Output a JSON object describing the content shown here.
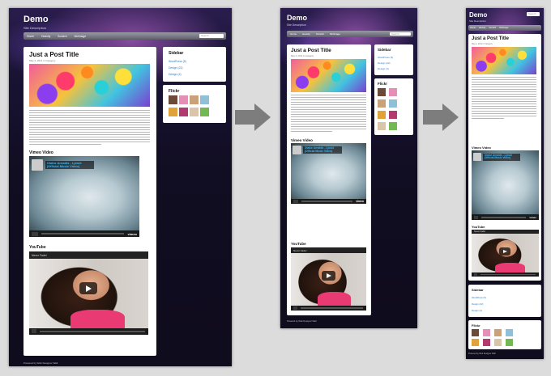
{
  "site": {
    "title": "Demo",
    "description": "Site Description"
  },
  "nav": [
    "Home",
    "Heavily",
    "Scratch",
    "Mclimage"
  ],
  "search": {
    "placeholder": "Search"
  },
  "post": {
    "title": "Just a Post Title",
    "meta": "May 4, 2011 in Category",
    "vimeo_heading": "Vimeo Video",
    "vimeo_title": "Olafur Arnalds - Ljósiö (Official Music Video)",
    "vimeo_logo": "vimeo",
    "youtube_heading": "YouTube",
    "youtube_title": "Never Fade!",
    "youtube_share": "Share"
  },
  "sidebar": {
    "title": "Sidebar",
    "links": [
      "WordPress (5)",
      "Design (22)",
      "Design (4)"
    ]
  },
  "flickr": {
    "title": "Flickr"
  },
  "footer": {
    "text": "Powered by Web Designer Wall"
  },
  "colors": {
    "accent": "#2e78c2",
    "vimeo_title": "#33b6ff",
    "arrow": "#7d7d7d"
  }
}
